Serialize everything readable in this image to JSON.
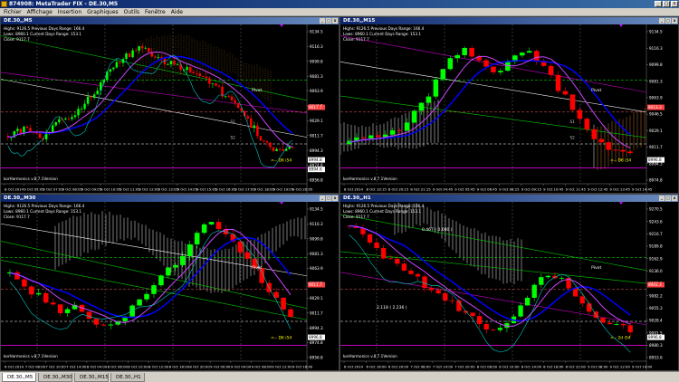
{
  "window": {
    "title": "874908: MetaTrader FIX - DE.30,M5"
  },
  "menu": [
    "Fichier",
    "Affichage",
    "Insertion",
    "Graphiques",
    "Outils",
    "Fenêtre",
    "Aide"
  ],
  "tabs": [
    {
      "label": "DE.30,,M5",
      "active": true
    },
    {
      "label": "DE.30,,M30",
      "active": false
    },
    {
      "label": "DE.30,,M15",
      "active": false
    },
    {
      "label": "DE.30,,H1",
      "active": false
    }
  ],
  "charts": [
    {
      "id": "m5",
      "title": "DE.30,,M5",
      "info": [
        "Highs: 9126.5    Previous Days Range: 166.4",
        "Lows: 8960.1    Current Days Range: 153.1",
        "Close: 9117.7"
      ],
      "watermark": "korHarmonics v.8.7.1Version",
      "prices": [
        "9134.5",
        "9116.3",
        "9099.8",
        "9081.3",
        "9063.9",
        "9046.5",
        "9029.1",
        "9011.7",
        "8994.3",
        "8974.8",
        "8956.8"
      ],
      "current": "9017.7",
      "tags": [
        "8994.8",
        "8994.6"
      ],
      "labels": [
        "Pivot",
        "S1",
        "S2"
      ],
      "pivot_text": "Pivot",
      "dist_text": "<-- D6 i54",
      "dates": [
        "8 Oct 2014",
        "9 Oct 05:05",
        "9 Oct 07:05",
        "9 Oct 08:05",
        "9 Oct 09:05",
        "9 Oct 10:05",
        "9 Oct 11:05",
        "9 Oct 12:05",
        "9 Oct 13:05",
        "9 Oct 14:05",
        "9 Oct 15:05",
        "9 Oct 16:05",
        "9 Oct 17:05",
        "9 Oct 18:05",
        "9 Oct 19:05",
        "9 Oct 20:05"
      ],
      "datesShort": [
        "8 Oct 2014",
        "9 Oct 05:05",
        "9 Oct 06:55",
        "9 Oct 08:05",
        "9 Oct 09:05",
        "9 Oct 10:05",
        "9 Oct 11:05",
        "9 Oct 12:05",
        "9 Oct 13:05"
      ]
    },
    {
      "id": "m15",
      "title": "DE.30,,M15",
      "info": [
        "Highs: 9126.5    Previous Days Range: 166.4",
        "Lows: 8960.1    Current Days Range: 153.1",
        "Close: 9117.7"
      ],
      "watermark": "korHarmonics v.8.7.1Version",
      "prices": [
        "9134.5",
        "9116.3",
        "9099.8",
        "9081.3",
        "9063.9",
        "9046.5",
        "9029.1",
        "9011.7",
        "8994.3",
        "8974.8"
      ],
      "current": "9013.3",
      "tags": [
        "8996.8"
      ],
      "labels": [
        "Pivot",
        "S1",
        "S2"
      ],
      "pivot_text": "Pivot",
      "dist_text": "<-- D6 i54",
      "dates": [
        "8 Oct 2014",
        "8 Oct 19:15",
        "8 Oct 20:15",
        "8 Oct 21:15",
        "9 Oct 04:45",
        "9 Oct 05:45",
        "9 Oct 06:45",
        "9 Oct 08:15",
        "9 Oct 09:15",
        "9 Oct 10:45",
        "9 Oct 11:45",
        "9 Oct 12:45",
        "9 Oct 13:45",
        "9 Oct 14:45"
      ]
    },
    {
      "id": "m30",
      "title": "DE.30,,M30",
      "info": [
        "Highs: 9126.5    Previous Days Range: 166.4",
        "Lows: 8960.1    Current Days Range: 153.1",
        "Close: 9117.7"
      ],
      "watermark": "korHarmonics v.8.7.1Version",
      "prices": [
        "9134.5",
        "9116.3",
        "9099.8",
        "9081.3",
        "9063.9",
        "9046.5",
        "9029.1",
        "9011.7",
        "8994.3",
        "8974.8",
        "8956.8"
      ],
      "current": "9011.7",
      "tags": [
        "8996.8"
      ],
      "labels": [
        "Pivot"
      ],
      "pivot_text": "Pivot",
      "dist_text": "<-- D6 i54",
      "dates": [
        "6 Oct 2014",
        "7 Oct 08:00",
        "7 Oct 10:00",
        "7 Oct 14:00",
        "8 Oct 04:00",
        "8 Oct 06:00",
        "8 Oct 10:00",
        "8 Oct 12:00",
        "8 Oct 16:00",
        "8 Oct 20:00",
        "9 Oct 00:00",
        "9 Oct 04:00",
        "9 Oct 08:00",
        "9 Oct 12:00",
        "9 Oct 16:00"
      ]
    },
    {
      "id": "h1",
      "title": "DE.30,,H1",
      "info": [
        "Highs: 9126.5    Previous Days Range: 166.4",
        "Lows: 8960.1    Current Days Range: 153.1",
        "Close: 9117.7"
      ],
      "watermark": "korHarmonics v.8.7.1Version",
      "prices": [
        "9270.5",
        "9243.6",
        "9216.7",
        "9189.8",
        "9162.9",
        "9136.0",
        "9109.1",
        "9082.2",
        "9055.3",
        "9028.4",
        "9001.5",
        "8980.3",
        "8953.6"
      ],
      "current": "9001.3",
      "tags": [
        "8996.8"
      ],
      "labels": [
        "Pivot"
      ],
      "pivot_text": "Pivot",
      "dist_text": "<-- 2d i54",
      "ext_labels": [
        "0.467 ( 0.600 )",
        "2.118 ( 2.236 )"
      ],
      "dates": [
        "6 Oct 2014",
        "6 Oct 16:00",
        "6 Oct 20:00",
        "7 Oct 08:00",
        "7 Oct 14:00",
        "7 Oct 20:00",
        "8 Oct 08:00",
        "8 Oct 10:00",
        "8 Oct 14:00",
        "8 Oct 18:00",
        "8 Oct 22:00",
        "9 Oct 08:00",
        "9 Oct 12:00",
        "9 Oct 14:00"
      ]
    }
  ],
  "colors": {
    "bull": "#00ff00",
    "bear": "#ff0000",
    "background": "#000000",
    "ma_blue": "#0000ff",
    "ma_magenta": "#cc44ff",
    "cyan": "#00c8c8",
    "yellow": "#ffff00"
  }
}
